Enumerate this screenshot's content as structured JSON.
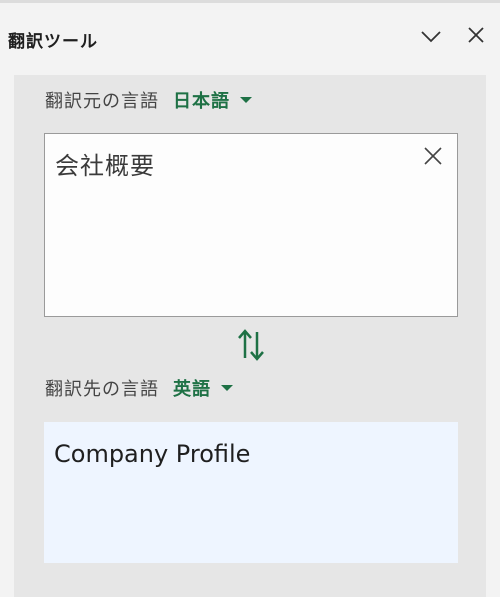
{
  "header": {
    "title": "翻訳ツール",
    "collapse_icon": "chevron-down-icon",
    "close_icon": "close-icon"
  },
  "source": {
    "label": "翻訳元の言語",
    "language": "日本語",
    "text": "会社概要",
    "clear_icon": "close-icon"
  },
  "swap_icon": "swap-vertical-icon",
  "target": {
    "label": "翻訳先の言語",
    "language": "英語",
    "text": "Company Profile"
  },
  "colors": {
    "accent": "#1e7145",
    "panel_bg": "#e6e6e6",
    "output_bg": "#eef5ff"
  }
}
